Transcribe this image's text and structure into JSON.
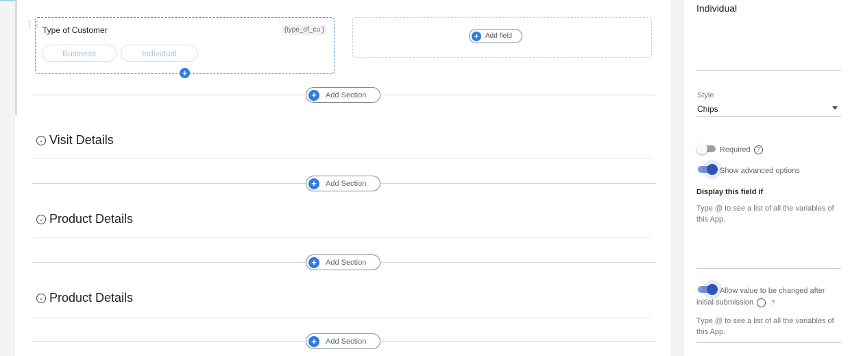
{
  "canvas": {
    "field_card": {
      "title": "Type of Customer",
      "variable": "{type_of_cu }",
      "options": [
        "Business",
        "Individual"
      ]
    },
    "empty_slot": {
      "add_field_label": "Add field"
    },
    "add_section_label": "Add Section",
    "sections": [
      {
        "title": "Visit Details"
      },
      {
        "title": "Product Details"
      },
      {
        "title": "Product Details"
      }
    ]
  },
  "panel": {
    "top_value": "Individual",
    "style_label": "Style",
    "style_value": "Chips",
    "required_label": "Required",
    "required_on": false,
    "advanced_label": "Show advanced options",
    "advanced_on": true,
    "display_if_label": "Display this field if",
    "display_if_hint": "Type @ to see a list of all the variables of this App.",
    "allow_change_label": "Allow value to be changed after initial submission",
    "allow_change_on": true,
    "allow_change_hint": "Type @ to see a list of all the variables of this App.",
    "colors": {
      "accent": "#2f7be0",
      "toggle_on": "#2f53b4"
    }
  }
}
